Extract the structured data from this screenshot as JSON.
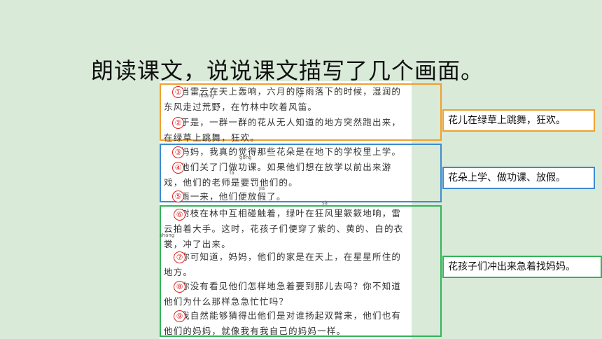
{
  "title": "朗读课文，说说课文描写了几个画面。",
  "pinyin": {
    "huang": "huāng",
    "di": "dí",
    "gong": "gōng",
    "fa": "fá",
    "jia": "jià",
    "sa": "sà",
    "shang": "shang"
  },
  "paragraphs": [
    {
      "num": "①",
      "text": "当雷云在天上轰响，六月的阵雨落下的时候，湿润的东风走过荒野，在竹林中吹着风笛。"
    },
    {
      "num": "②",
      "text": "于是，一群一群的花从无人知道的地方突然跑出来，在绿草上跳舞，狂欢。"
    },
    {
      "num": "③",
      "text": "妈妈，我真的觉得那些花朵是在地下的学校里上学。"
    },
    {
      "num": "④",
      "text": "他们关了门做功课。如果他们想在放学以前出来游戏，他们的老师是要罚他们的。"
    },
    {
      "num": "⑤",
      "text": "雨一来，他们便放假了。"
    },
    {
      "num": "⑥",
      "text": "树枝在林中互相碰触着，绿叶在狂风里簌簌地响，雷云拍着大手。这时，花孩子们便穿了紫的、黄的、白的衣裳，冲了出来。"
    },
    {
      "num": "⑦",
      "text": "你可知道，妈妈，他们的家是在天上，在星星所住的地方。"
    },
    {
      "num": "⑧",
      "text": "你没有看见他们怎样地急着要到那儿去吗？你不知道他们为什么那样急急忙忙吗？"
    },
    {
      "num": "⑨",
      "text": "我自然能够猜得出他们是对谁扬起双臂来，他们也有他们的妈妈，就像我有我自己的妈妈一样。"
    }
  ],
  "notes": [
    "花儿在绿草上跳舞，狂欢。",
    "花朵上学、做功课、放假。",
    "花孩子们冲出来急着找妈妈。"
  ],
  "colors": {
    "background": "#d9ead8",
    "frame_orange": "#f0a030",
    "frame_blue": "#3d8bd0",
    "frame_green": "#35b35a",
    "number_red": "#e02020"
  }
}
